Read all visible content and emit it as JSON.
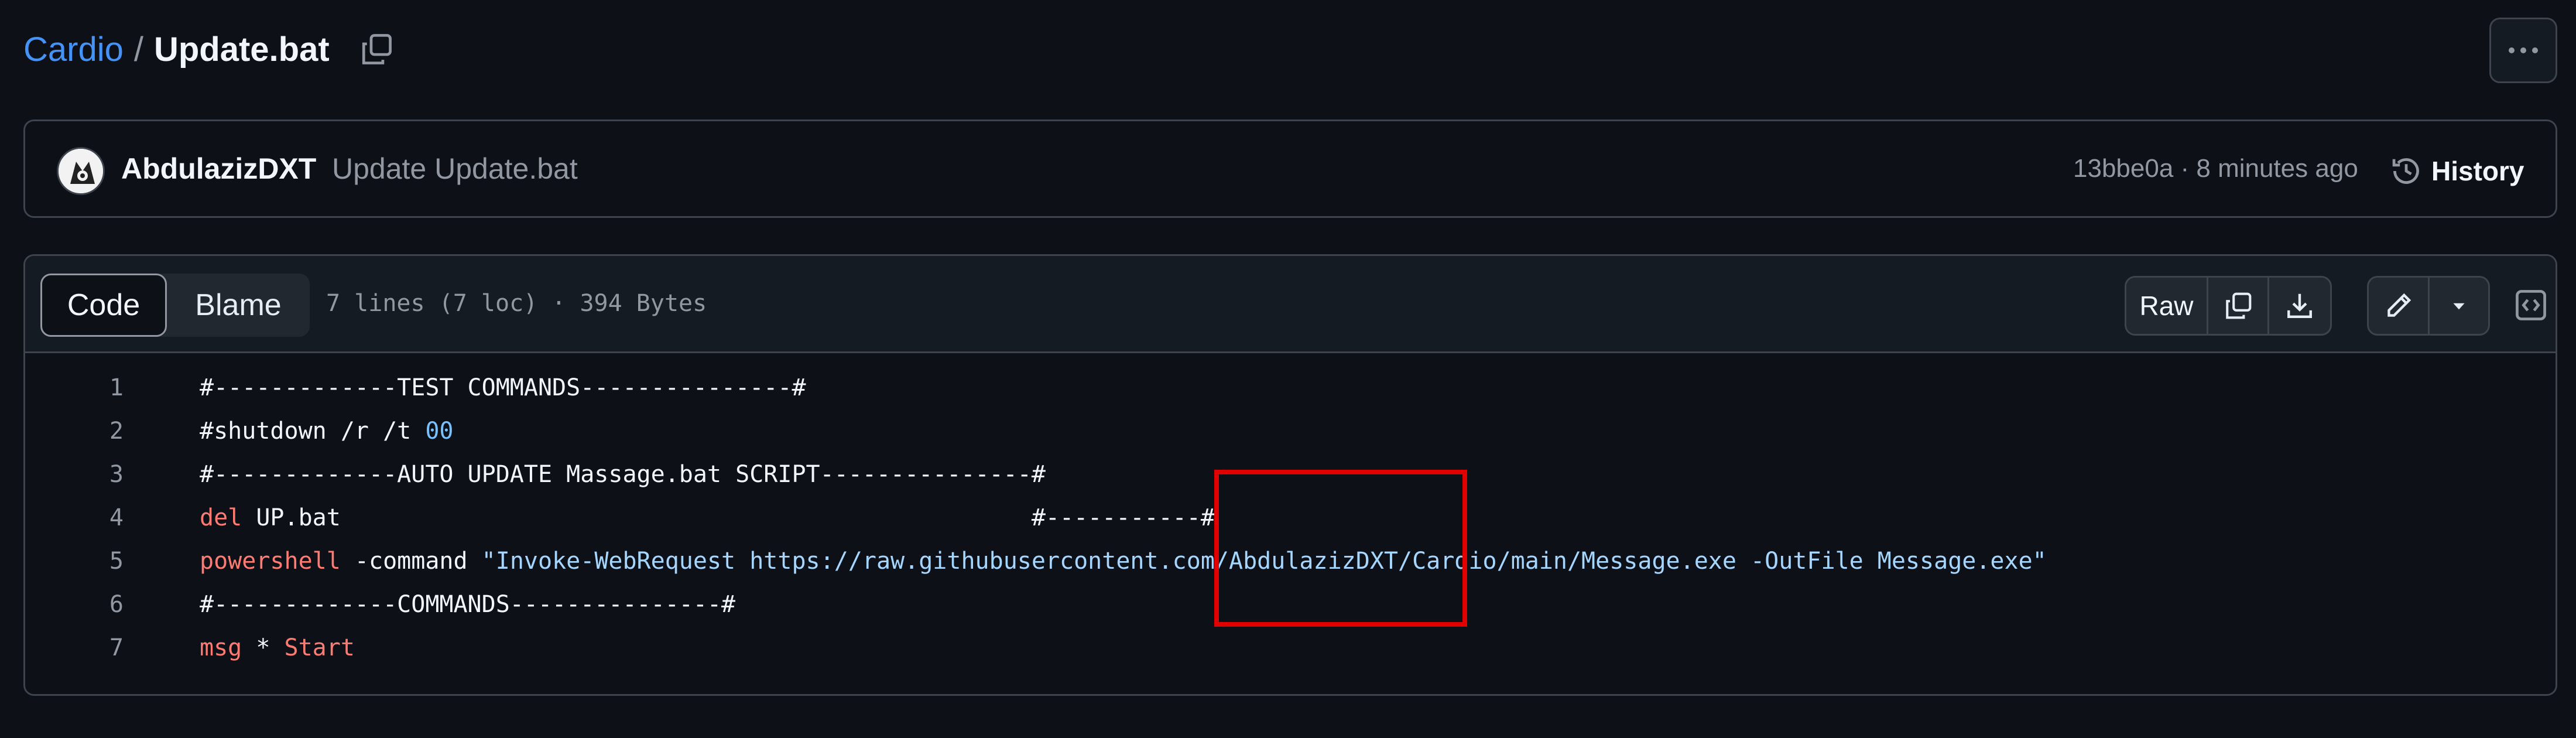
{
  "breadcrumb": {
    "repo": "Cardio",
    "separator": "/",
    "file": "Update.bat"
  },
  "commit": {
    "author": "AbdulazizDXT",
    "message": "Update Update.bat",
    "meta": "13bbe0a · 8 minutes ago",
    "history_label": "History"
  },
  "toolbar": {
    "code_tab": "Code",
    "blame_tab": "Blame",
    "file_info": "7 lines (7 loc) · 394 Bytes",
    "raw_label": "Raw"
  },
  "code_lines": [
    {
      "n": "1",
      "parts": [
        [
          "#-------------TEST COMMANDS---------------#",
          ""
        ]
      ]
    },
    {
      "n": "2",
      "parts": [
        [
          "#shutdown /r /t ",
          ""
        ],
        [
          "00",
          "num"
        ]
      ]
    },
    {
      "n": "3",
      "parts": [
        [
          "#-------------AUTO UPDATE Massage.bat SCRIPT---------------#",
          ""
        ]
      ]
    },
    {
      "n": "4",
      "parts": [
        [
          "del",
          "kw"
        ],
        [
          " UP.bat                                                 #-----------#",
          ""
        ]
      ]
    },
    {
      "n": "5",
      "parts": [
        [
          "powershell",
          "kw"
        ],
        [
          " -command ",
          ""
        ],
        [
          "\"Invoke-WebRequest https://raw.githubusercontent.com/AbdulazizDXT/Cardio/main/Message.exe -OutFile Message.exe\"",
          "str"
        ]
      ]
    },
    {
      "n": "6",
      "parts": [
        [
          "#-------------COMMANDS---------------#",
          ""
        ]
      ]
    },
    {
      "n": "7",
      "parts": [
        [
          "msg",
          "kw"
        ],
        [
          " * ",
          ""
        ],
        [
          "Start",
          "kw"
        ]
      ]
    }
  ],
  "colors": {
    "accent": "#4493f8",
    "highlight_box": "#e00000",
    "background": "#0d1117"
  },
  "icons": [
    "copy-path-icon",
    "kebab-icon",
    "avatar",
    "history-icon",
    "copy-icon",
    "download-icon",
    "pencil-icon",
    "chevron-down-icon",
    "symbols-icon"
  ]
}
